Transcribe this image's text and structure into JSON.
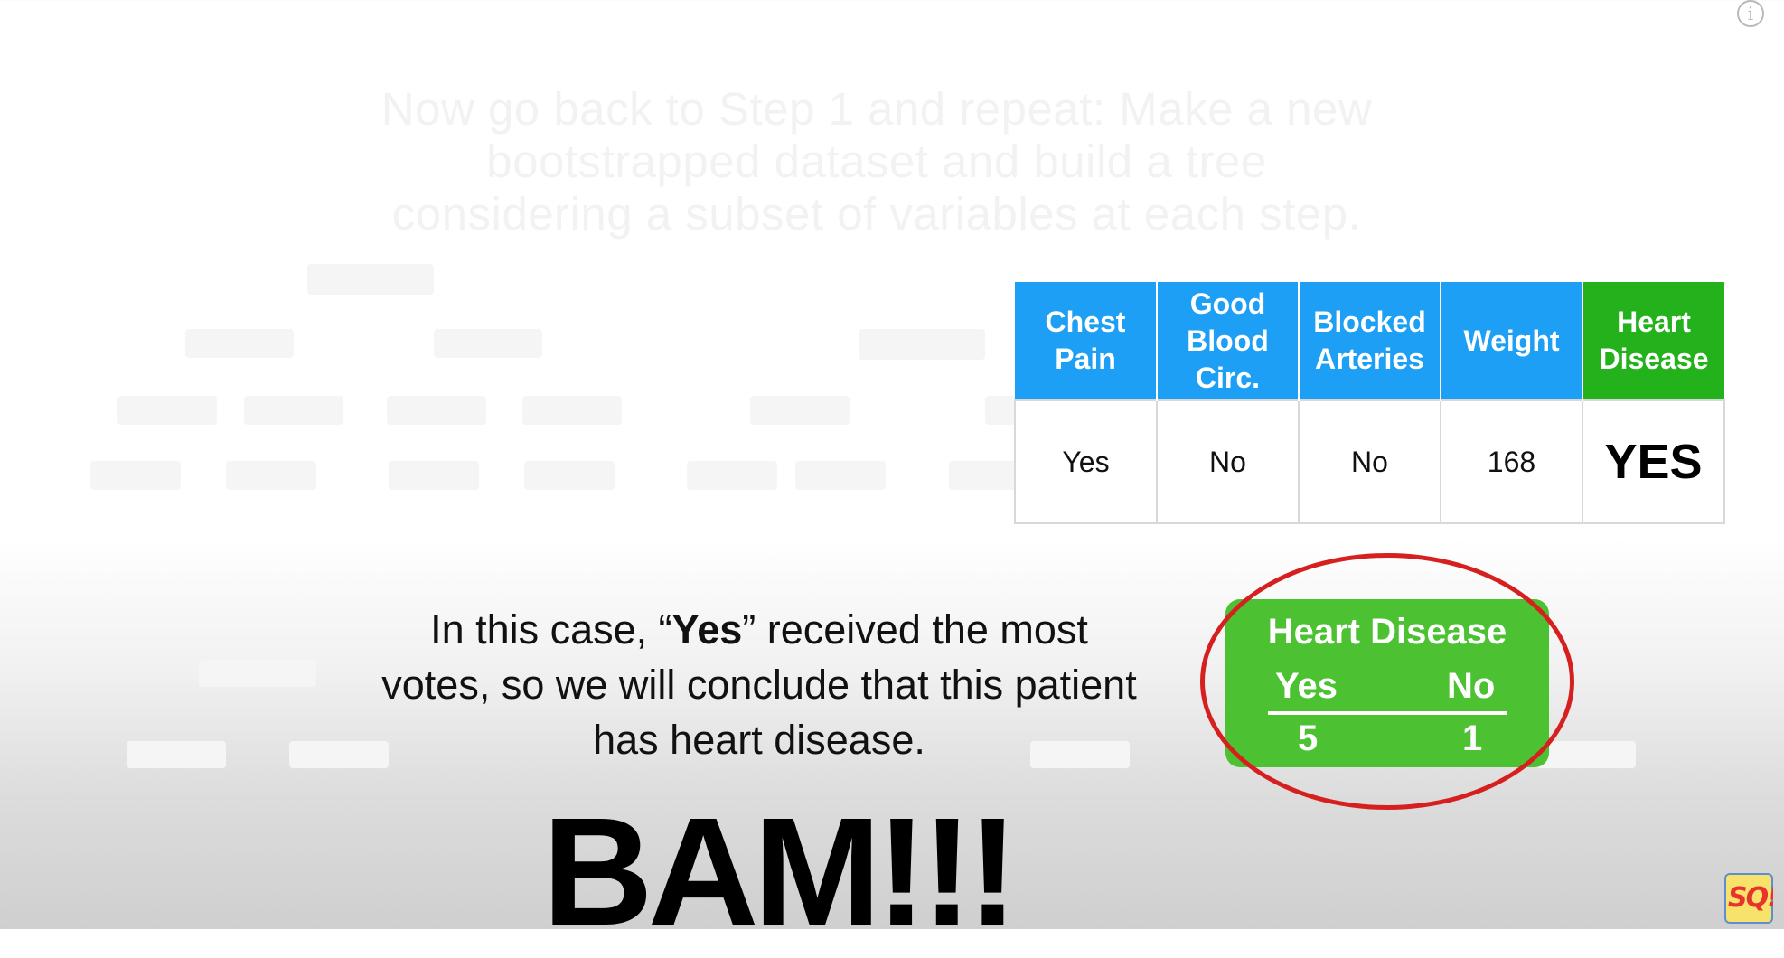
{
  "info_icon_glyph": "i",
  "faded_title": "Now go back to Step 1 and repeat: Make a new bootstrapped dataset and build a tree considering a subset of variables at each step.",
  "table": {
    "headers": [
      "Chest Pain",
      "Good Blood Circ.",
      "Blocked Arteries",
      "Weight",
      "Heart Disease"
    ],
    "row": [
      "Yes",
      "No",
      "No",
      "168",
      "YES"
    ],
    "colors": {
      "header_blue": "#1c9ff5",
      "header_green": "#23b21c"
    }
  },
  "sentence": {
    "part1": "In this case, “",
    "bold": "Yes",
    "part2": "” received the most votes, so we will conclude that this patient has heart disease."
  },
  "bam": "BAM!!!",
  "votes": {
    "title": "Heart Disease",
    "yes_label": "Yes",
    "no_label": "No",
    "yes_count": "5",
    "no_count": "1",
    "colors": {
      "box": "#4cc232",
      "ring": "#d62020"
    }
  },
  "logo": {
    "text": "SQ!",
    "icon": "statquest-logo-icon"
  }
}
